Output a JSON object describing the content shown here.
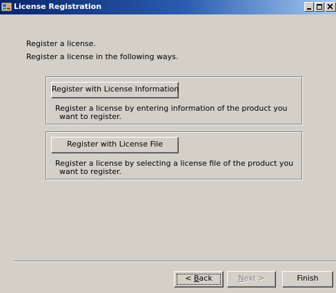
{
  "window": {
    "title": "License Registration",
    "icon": "license-app-icon"
  },
  "intro": {
    "line1": "Register a license.",
    "line2": "Register a license in the following ways."
  },
  "options": [
    {
      "button_label": "Register with License Information",
      "desc_line1": "Register a license by entering information of the product you",
      "desc_line2": "want to register."
    },
    {
      "button_label": "Register with License File",
      "desc_line1": "Register a license by selecting a license file of the product you",
      "desc_line2": "want to register."
    }
  ],
  "footer": {
    "back_prefix": "< ",
    "back_mnemonic": "B",
    "back_rest": "ack",
    "next_mnemonic": "N",
    "next_rest": "ext >",
    "finish_label": "Finish",
    "next_enabled": false
  },
  "colors": {
    "titlebar_start": "#0a246a",
    "titlebar_end": "#a6caf0",
    "face": "#d4d0c8",
    "disabled_text": "#808080"
  }
}
